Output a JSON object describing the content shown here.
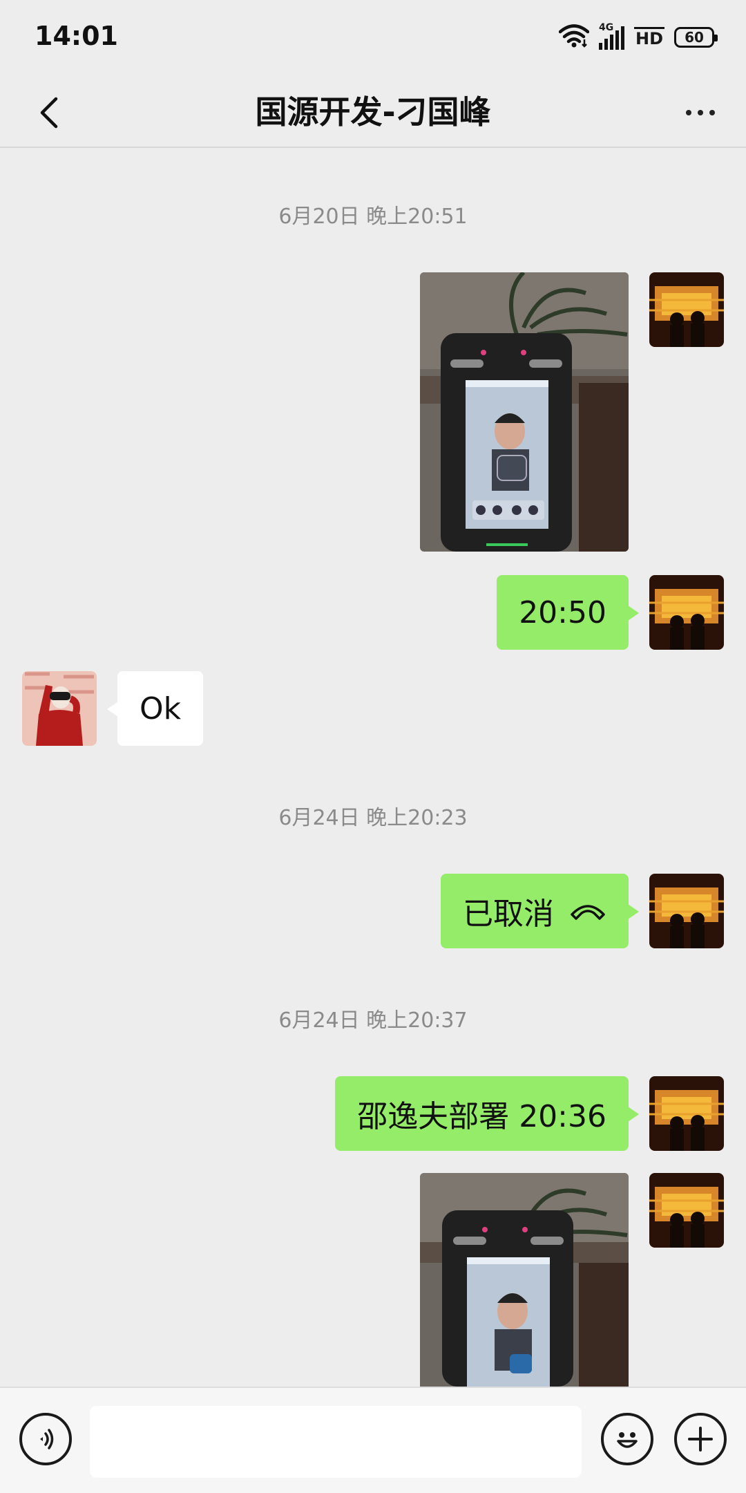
{
  "status_bar": {
    "time": "14:01",
    "network": "4G",
    "hd_label": "HD",
    "battery": "60",
    "icons": [
      "wifi-icon",
      "signal-icon",
      "hd-icon",
      "battery-icon"
    ]
  },
  "header": {
    "title": "国源开发-刁国峰",
    "back_icon": "chevron-left-icon",
    "more_icon": "more-dots-icon"
  },
  "timestamps": [
    "6月20日 晚上20:51",
    "6月24日 晚上20:23",
    "6月24日 晚上20:37"
  ],
  "messages": {
    "m1": {
      "type": "image",
      "sender": "me",
      "content": "photo of face recognition terminal"
    },
    "m2": {
      "type": "text",
      "sender": "me",
      "text": "20:50"
    },
    "m3": {
      "type": "text",
      "sender": "contact",
      "text": "Ok"
    },
    "m4": {
      "type": "call",
      "sender": "me",
      "text": "已取消",
      "icon": "hangup-phone-icon"
    },
    "m5": {
      "type": "text",
      "sender": "me",
      "text": "邵逸夫部署 20:36"
    },
    "m6": {
      "type": "image",
      "sender": "me",
      "content": "photo of face recognition terminal"
    }
  },
  "colors": {
    "background": "#ededed",
    "bubble_sent": "#95ec69",
    "bubble_received": "#ffffff",
    "timestamp": "#8a8a8a"
  },
  "input_bar": {
    "value": "",
    "icons": [
      "voice-icon",
      "emoji-icon",
      "plus-icon"
    ]
  }
}
